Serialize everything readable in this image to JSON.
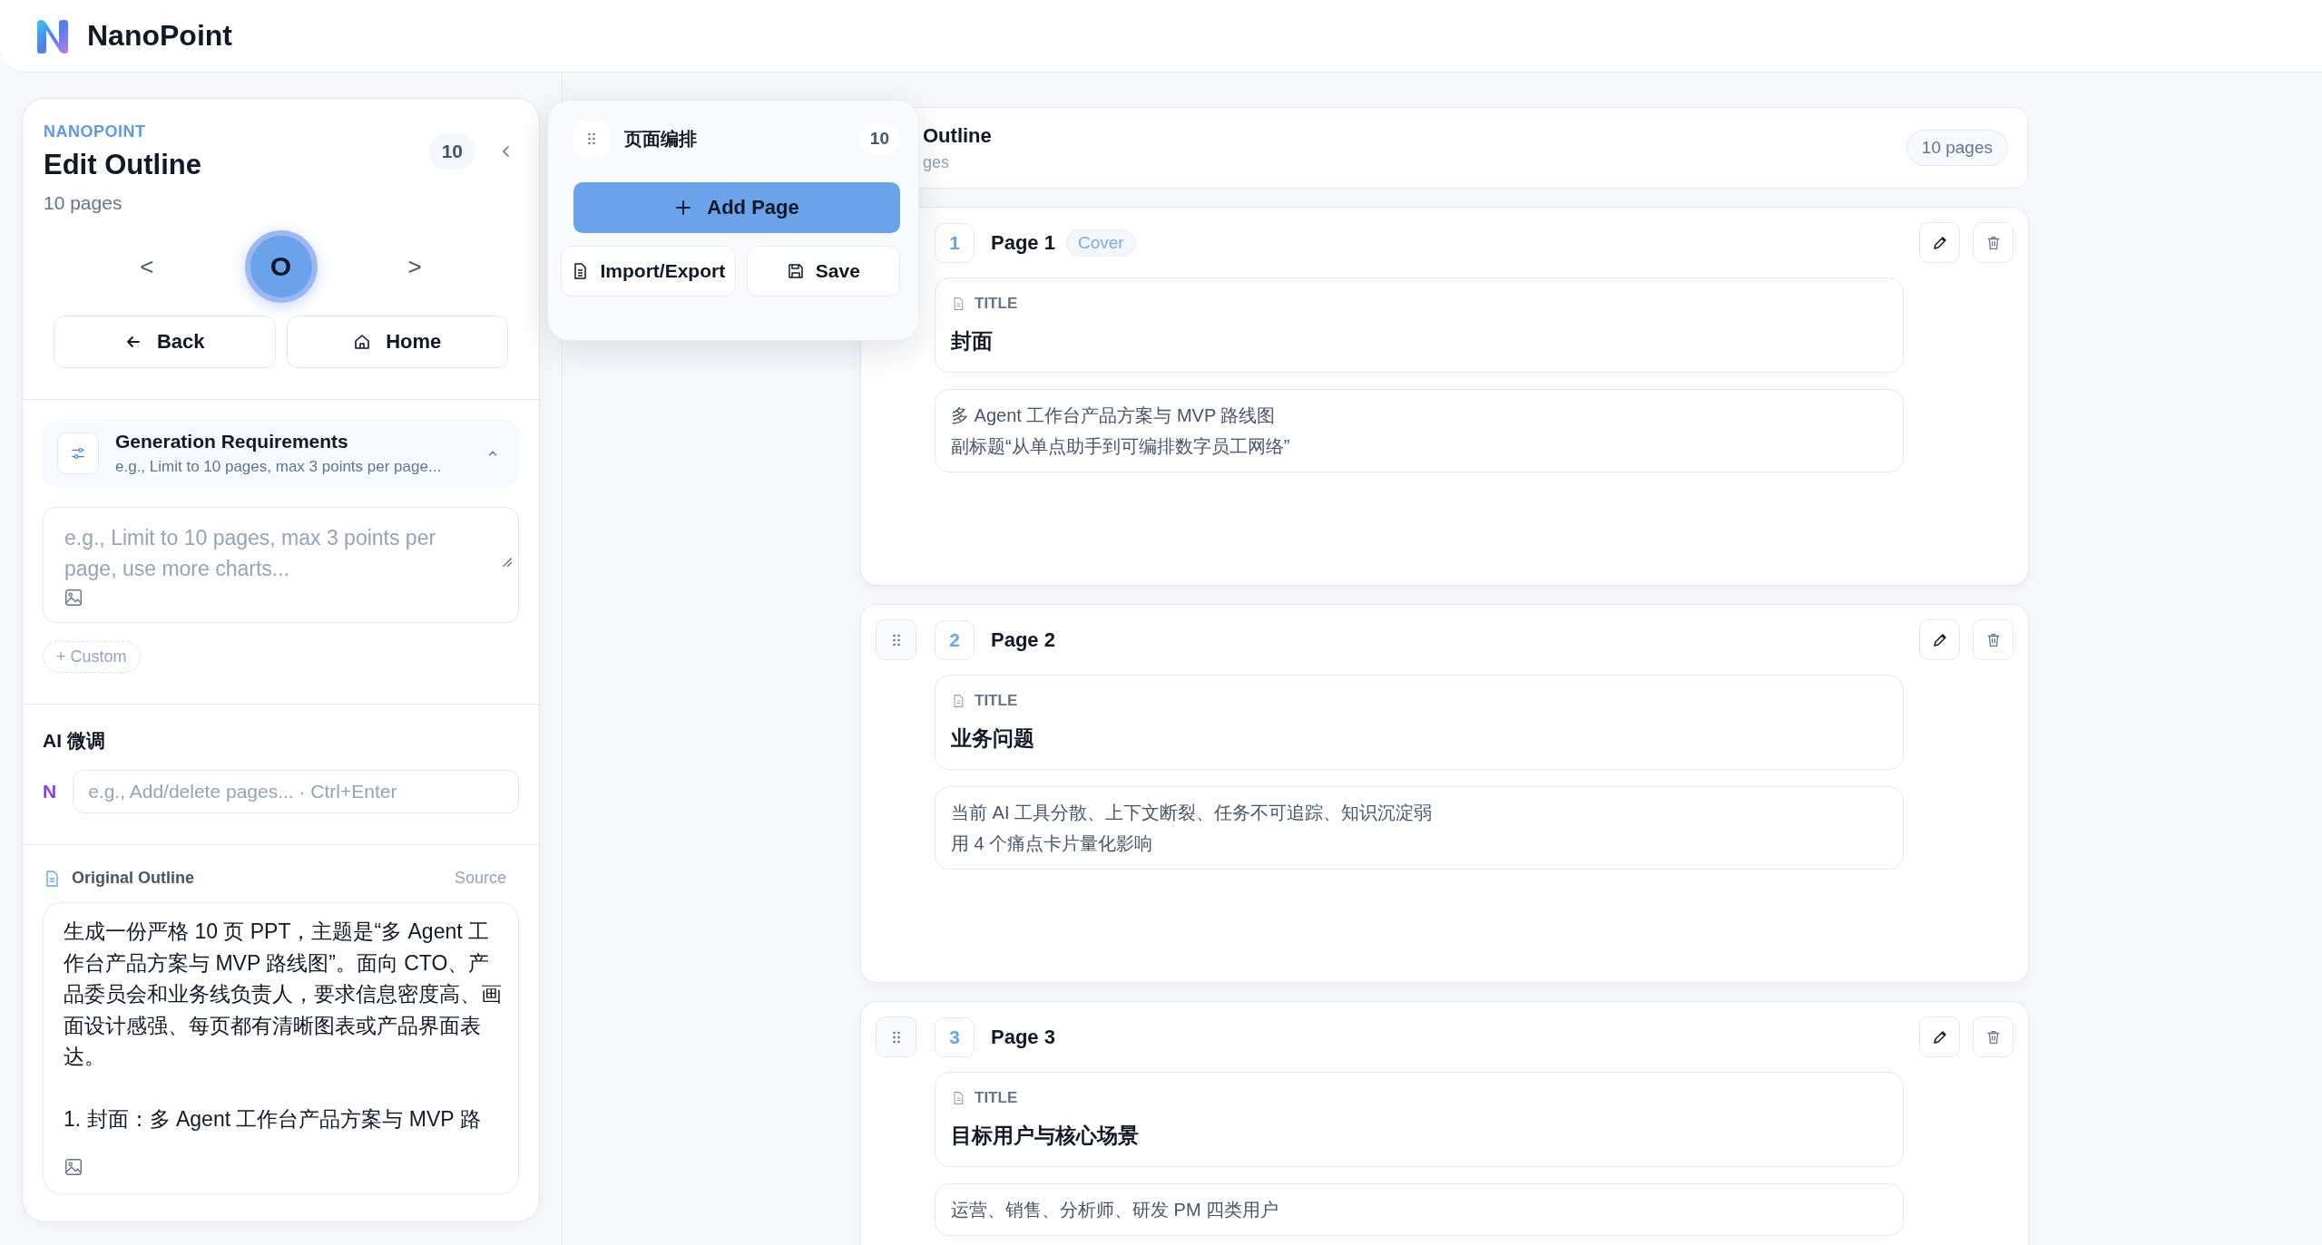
{
  "app": {
    "name": "NanoPoint"
  },
  "sidebar": {
    "eyebrow": "NANOPOINT",
    "title": "Edit Outline",
    "subtitle": "10 pages",
    "count": "10",
    "prev": "<",
    "current": "O",
    "next": ">",
    "buttons": [
      {
        "label": "Back",
        "kind": "back"
      },
      {
        "label": "Home",
        "kind": "home"
      }
    ]
  },
  "requirements": {
    "title": "Generation Requirements",
    "summary": "e.g., Limit to 10 pages, max 3 points per page...",
    "expanded": true,
    "placeholder": "e.g., Limit to 10 pages, max 3 points per page, use more charts...",
    "custom": "+ Custom"
  },
  "ai_tune": {
    "label": "AI 微调",
    "badge": "N",
    "placeholder": "e.g., Add/delete pages... · Ctrl+Enter"
  },
  "original_outline": {
    "title": "Original Outline",
    "source": "Source",
    "paragraphs": [
      "生成一份严格 10 页 PPT，主题是“多 Agent 工作台产品方案与 MVP 路线图”。面向 CTO、产品委员会和业务线负责人，要求信息密度高、画面设计感强、每页都有清晰图表或产品界面表达。",
      "1. 封面：多 Agent 工作台产品方案与 MVP 路"
    ]
  },
  "arrange_panel": {
    "title": "页面编排",
    "count": "10",
    "add": "Add Page",
    "import_export": "Import/Export",
    "save": "Save"
  },
  "outline_header": {
    "title": "Outline",
    "subtitle": "ges",
    "count": "10 pages"
  },
  "pages": [
    {
      "number": "1",
      "title": "Page 1",
      "tag": "Cover",
      "field_label": "TITLE",
      "heading": "封面",
      "notes": [
        "多 Agent 工作台产品方案与 MVP 路线图",
        "副标题“从单点助手到可编排数字员工网络”"
      ]
    },
    {
      "number": "2",
      "title": "Page 2",
      "field_label": "TITLE",
      "heading": "业务问题",
      "notes": [
        "当前 AI 工具分散、上下文断裂、任务不可追踪、知识沉淀弱",
        "用 4 个痛点卡片量化影响"
      ]
    },
    {
      "number": "3",
      "title": "Page 3",
      "field_label": "TITLE",
      "heading": "目标用户与核心场景",
      "notes": [
        "运营、销售、分析师、研发 PM 四类用户"
      ]
    }
  ]
}
